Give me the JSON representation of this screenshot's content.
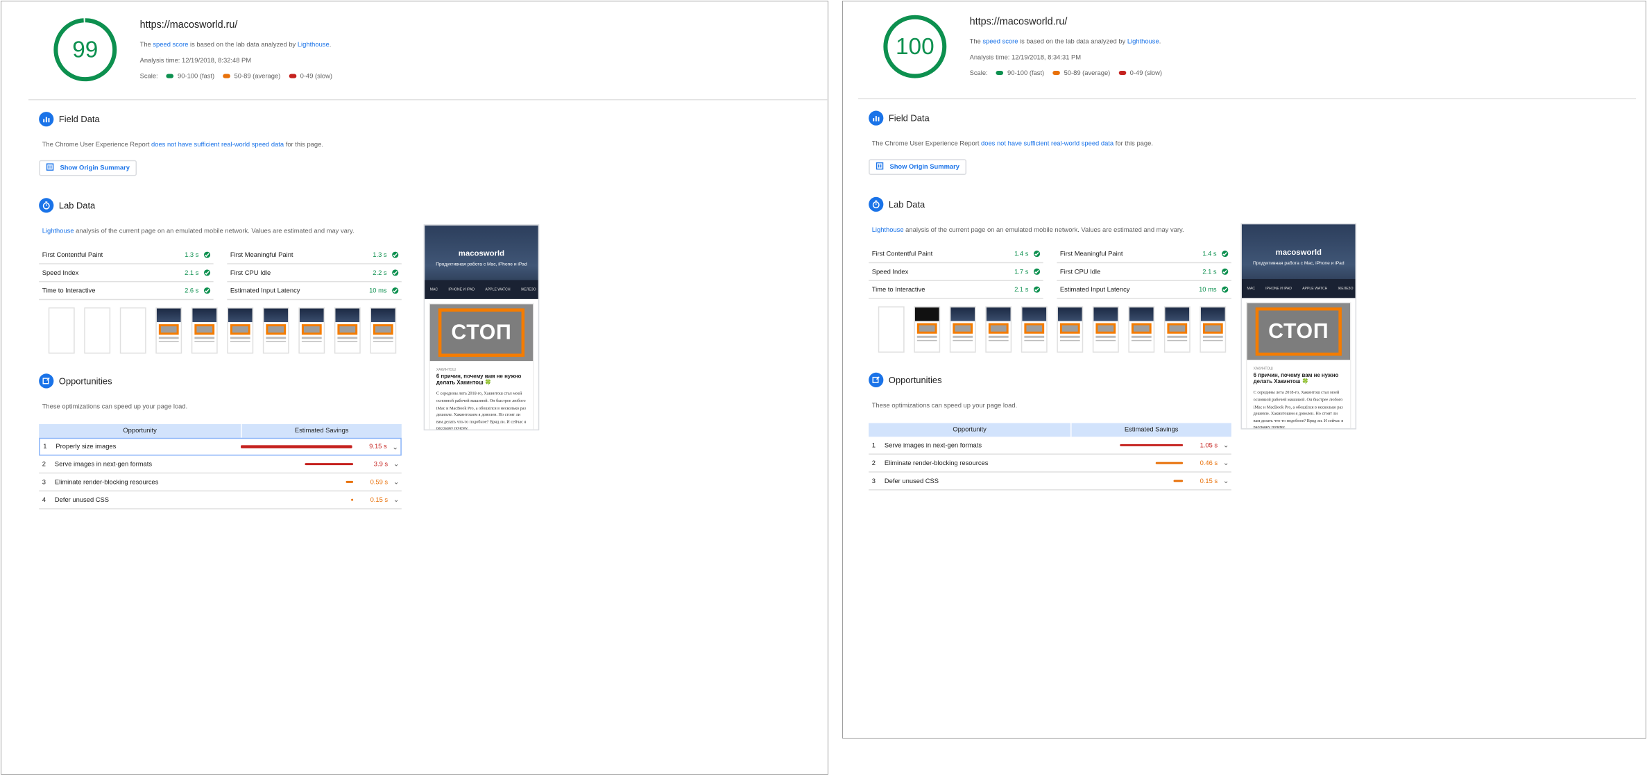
{
  "colors": {
    "fast": "#0d904f",
    "average": "#e8710a",
    "slow": "#c5221f",
    "accent": "#1a73e8"
  },
  "left": {
    "score": "99",
    "score_fraction": 0.99,
    "url": "https://macosworld.ru/",
    "note": {
      "pre": "The ",
      "speed": "speed score",
      "mid": " is based on the lab data analyzed by ",
      "lighthouse": "Lighthouse",
      "post": "."
    },
    "analysis_time": "Analysis time: 12/19/2018, 8:32:48 PM",
    "scale": {
      "label": "Scale:",
      "fast": "90-100 (fast)",
      "average": "50-89 (average)",
      "slow": "0-49 (slow)"
    },
    "field": {
      "title": "Field Data",
      "desc_pre": "The Chrome User Experience Report ",
      "desc_link": "does not have sufficient real-world speed data",
      "desc_post": " for this page.",
      "button": "Show Origin Summary"
    },
    "lab": {
      "title": "Lab Data",
      "desc_link": "Lighthouse",
      "desc_post": " analysis of the current page on an emulated mobile network. Values are estimated and may vary."
    },
    "metrics": [
      {
        "label": "First Contentful Paint",
        "value": "1.3 s"
      },
      {
        "label": "First Meaningful Paint",
        "value": "1.3 s"
      },
      {
        "label": "Speed Index",
        "value": "2.1 s"
      },
      {
        "label": "First CPU Idle",
        "value": "2.2 s"
      },
      {
        "label": "Time to Interactive",
        "value": "2.6 s"
      },
      {
        "label": "Estimated Input Latency",
        "value": "10 ms"
      }
    ],
    "opp": {
      "title": "Opportunities",
      "desc": "These optimizations can speed up your page load.",
      "col1": "Opportunity",
      "col2": "Estimated Savings",
      "rows": [
        {
          "idx": "1",
          "title": "Properly size images",
          "savings": "9.15 s",
          "fraction": 1.0,
          "level": "slow"
        },
        {
          "idx": "2",
          "title": "Serve images in next-gen formats",
          "savings": "3.9 s",
          "fraction": 0.43,
          "level": "slow"
        },
        {
          "idx": "3",
          "title": "Eliminate render-blocking resources",
          "savings": "0.59 s",
          "fraction": 0.065,
          "level": "average"
        },
        {
          "idx": "4",
          "title": "Defer unused CSS",
          "savings": "0.15 s",
          "fraction": 0.017,
          "level": "average"
        }
      ]
    }
  },
  "right": {
    "score": "100",
    "score_fraction": 1.0,
    "url": "https://macosworld.ru/",
    "note": {
      "pre": "The ",
      "speed": "speed score",
      "mid": " is based on the lab data analyzed by ",
      "lighthouse": "Lighthouse",
      "post": "."
    },
    "analysis_time": "Analysis time: 12/19/2018, 8:34:31 PM",
    "scale": {
      "label": "Scale:",
      "fast": "90-100 (fast)",
      "average": "50-89 (average)",
      "slow": "0-49 (slow)"
    },
    "field": {
      "title": "Field Data",
      "desc_pre": "The Chrome User Experience Report ",
      "desc_link": "does not have sufficient real-world speed data",
      "desc_post": " for this page.",
      "button": "Show Origin Summary"
    },
    "lab": {
      "title": "Lab Data",
      "desc_link": "Lighthouse",
      "desc_post": " analysis of the current page on an emulated mobile network. Values are estimated and may vary."
    },
    "metrics": [
      {
        "label": "First Contentful Paint",
        "value": "1.4 s"
      },
      {
        "label": "First Meaningful Paint",
        "value": "1.4 s"
      },
      {
        "label": "Speed Index",
        "value": "1.7 s"
      },
      {
        "label": "First CPU Idle",
        "value": "2.1 s"
      },
      {
        "label": "Time to Interactive",
        "value": "2.1 s"
      },
      {
        "label": "Estimated Input Latency",
        "value": "10 ms"
      }
    ],
    "opp": {
      "title": "Opportunities",
      "desc": "These optimizations can speed up your page load.",
      "col1": "Opportunity",
      "col2": "Estimated Savings",
      "rows": [
        {
          "idx": "1",
          "title": "Serve images in next-gen formats",
          "savings": "1.05 s",
          "fraction": 1.0,
          "level": "slow"
        },
        {
          "idx": "2",
          "title": "Eliminate render-blocking resources",
          "savings": "0.46 s",
          "fraction": 0.44,
          "level": "average"
        },
        {
          "idx": "3",
          "title": "Defer unused CSS",
          "savings": "0.15 s",
          "fraction": 0.15,
          "level": "average"
        }
      ]
    }
  },
  "site_preview": {
    "logo": "macosworld",
    "tagline": "Продуктивная работа с Mac, iPhone и iPad",
    "nav": [
      "MAC",
      "IPHONE И IPAD",
      "APPLE WATCH",
      "ЖЕЛЕЗО"
    ],
    "image_word": "СТОП",
    "category": "ХАКИНТОШ",
    "headline": "6 причин, почему вам не нужно делать Хакинтош 🍀",
    "body": "С середины лета 2018-го, Хакинтош стал моей основной рабочей машиной. Он быстрее любого iMac и MacBook Pro, а обошёлся в несколько раз дешевле. Хакинтошем я доволен. Но стоит ли вам делать что-то подобное? Вряд ли. И сейчас я расскажу почему."
  }
}
